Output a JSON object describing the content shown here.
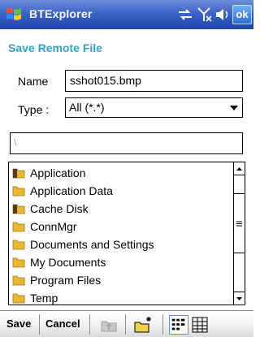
{
  "titlebar": {
    "app_title": "BTExplorer",
    "ok_label": "ok",
    "icons": [
      "windows-start-icon",
      "connectivity-icon",
      "signal-off-icon",
      "speaker-icon"
    ]
  },
  "dialog": {
    "heading": "Save Remote File",
    "name_label": "Name",
    "name_value": "sshot015.bmp",
    "type_label": "Type :",
    "type_value": "All (*.*)",
    "path_value": "\\"
  },
  "folders": [
    {
      "label": "Application",
      "icon": "special-folder-icon"
    },
    {
      "label": "Application Data",
      "icon": "folder-icon"
    },
    {
      "label": "Cache Disk",
      "icon": "special-folder-icon"
    },
    {
      "label": "ConnMgr",
      "icon": "folder-icon"
    },
    {
      "label": "Documents and Settings",
      "icon": "folder-icon"
    },
    {
      "label": "My Documents",
      "icon": "folder-icon"
    },
    {
      "label": "Program Files",
      "icon": "folder-icon"
    },
    {
      "label": "Temp",
      "icon": "folder-icon"
    }
  ],
  "toolbar": {
    "save_label": "Save",
    "cancel_label": "Cancel",
    "icons": [
      "up-folder-icon",
      "new-folder-icon",
      "list-view-icon",
      "details-view-icon"
    ]
  },
  "colors": {
    "titlebar": "#3a64c8",
    "heading": "#2ea3c8",
    "folder": "#e8b830"
  }
}
